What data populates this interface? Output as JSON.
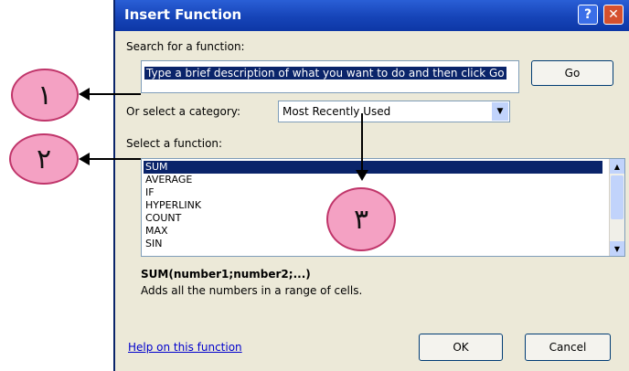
{
  "dialog": {
    "title": "Insert Function",
    "help_button": "?",
    "close_button": "✕",
    "search_label": "Search for a function:",
    "search_value": "Type a brief description of what you want to do and then click Go",
    "go_button": "Go",
    "category_label": "Or select a category:",
    "category_value": "Most Recently Used",
    "function_label": "Select a function:",
    "functions": [
      "SUM",
      "AVERAGE",
      "IF",
      "HYPERLINK",
      "COUNT",
      "MAX",
      "SIN"
    ],
    "selected_function": "SUM",
    "syntax": "SUM(number1;number2;...)",
    "description": "Adds all the numbers in a range of cells.",
    "help_link": "Help on this function",
    "ok_button": "OK",
    "cancel_button": "Cancel"
  },
  "callouts": {
    "c1": "١",
    "c2": "٢",
    "c3": "٣"
  },
  "colors": {
    "titlebar": "#1644b8",
    "dialog_bg": "#ece9d8",
    "selection": "#0a246a",
    "callout_fill": "#f4a1c3",
    "callout_border": "#c0356a"
  }
}
